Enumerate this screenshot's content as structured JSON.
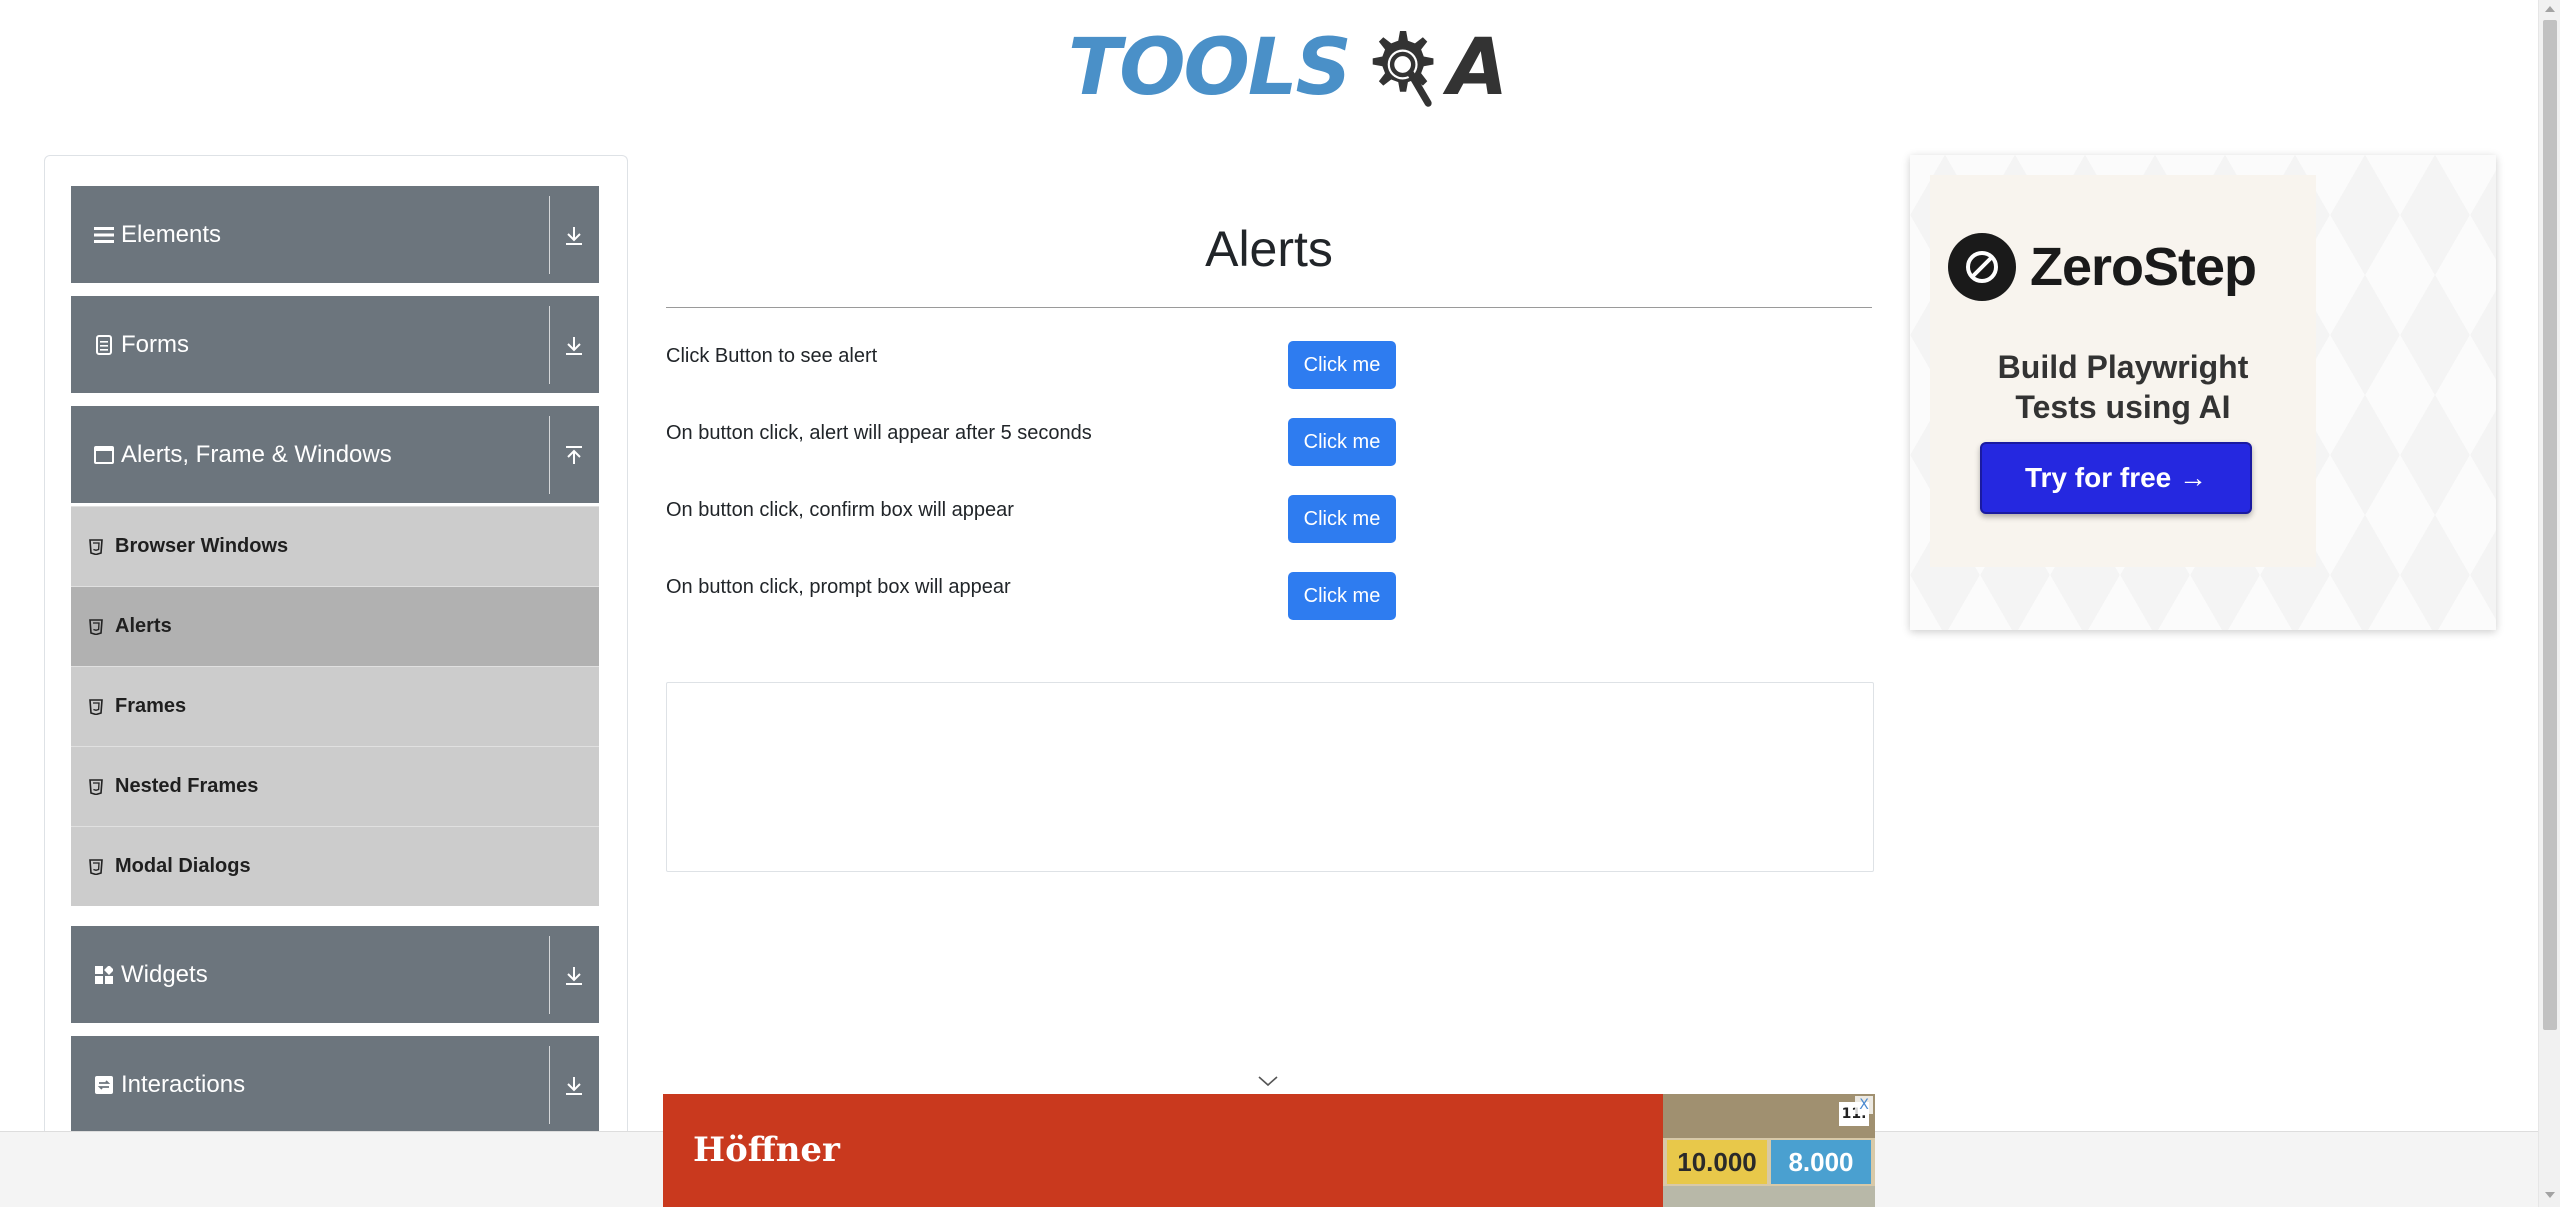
{
  "logo": {
    "text_left": "TOOLS",
    "text_right": "A",
    "alt": "TOOLSQA"
  },
  "sidebar": {
    "groups": [
      {
        "title": "Elements",
        "icon": "hamburger-icon",
        "expanded": false
      },
      {
        "title": "Forms",
        "icon": "document-icon",
        "expanded": false
      },
      {
        "title": "Alerts, Frame & Windows",
        "icon": "window-icon",
        "expanded": true,
        "items": [
          {
            "label": "Browser Windows",
            "active": false
          },
          {
            "label": "Alerts",
            "active": true
          },
          {
            "label": "Frames",
            "active": false
          },
          {
            "label": "Nested Frames",
            "active": false
          },
          {
            "label": "Modal Dialogs",
            "active": false
          }
        ]
      },
      {
        "title": "Widgets",
        "icon": "widgets-icon",
        "expanded": false
      },
      {
        "title": "Interactions",
        "icon": "interactions-icon",
        "expanded": false
      }
    ]
  },
  "main": {
    "title": "Alerts",
    "rows": [
      {
        "label": "Click Button to see alert",
        "button": "Click me"
      },
      {
        "label": "On button click, alert will appear after 5 seconds",
        "button": "Click me"
      },
      {
        "label": "On button click, confirm box will appear",
        "button": "Click me"
      },
      {
        "label": "On button click, prompt box will appear",
        "button": "Click me"
      }
    ]
  },
  "side_ad": {
    "brand": "ZeroStep",
    "headline_line1": "Build Playwright",
    "headline_line2": "Tests using AI",
    "cta": "Try for free →"
  },
  "bottom_ad": {
    "brand": "Höffner",
    "promo_value_1": "10.000",
    "promo_value_2": "8.000",
    "badge": "11.",
    "close": "X"
  },
  "colors": {
    "sidebar_group_bg": "#6c757d",
    "sidebar_items_bg": "#cccccc",
    "sidebar_active_bg": "#b1b1b1",
    "primary_button": "#2e7cf0",
    "logo_blue": "#4a90c8",
    "cta_blue": "#2528e0",
    "bottom_ad_red": "#c9391e"
  }
}
